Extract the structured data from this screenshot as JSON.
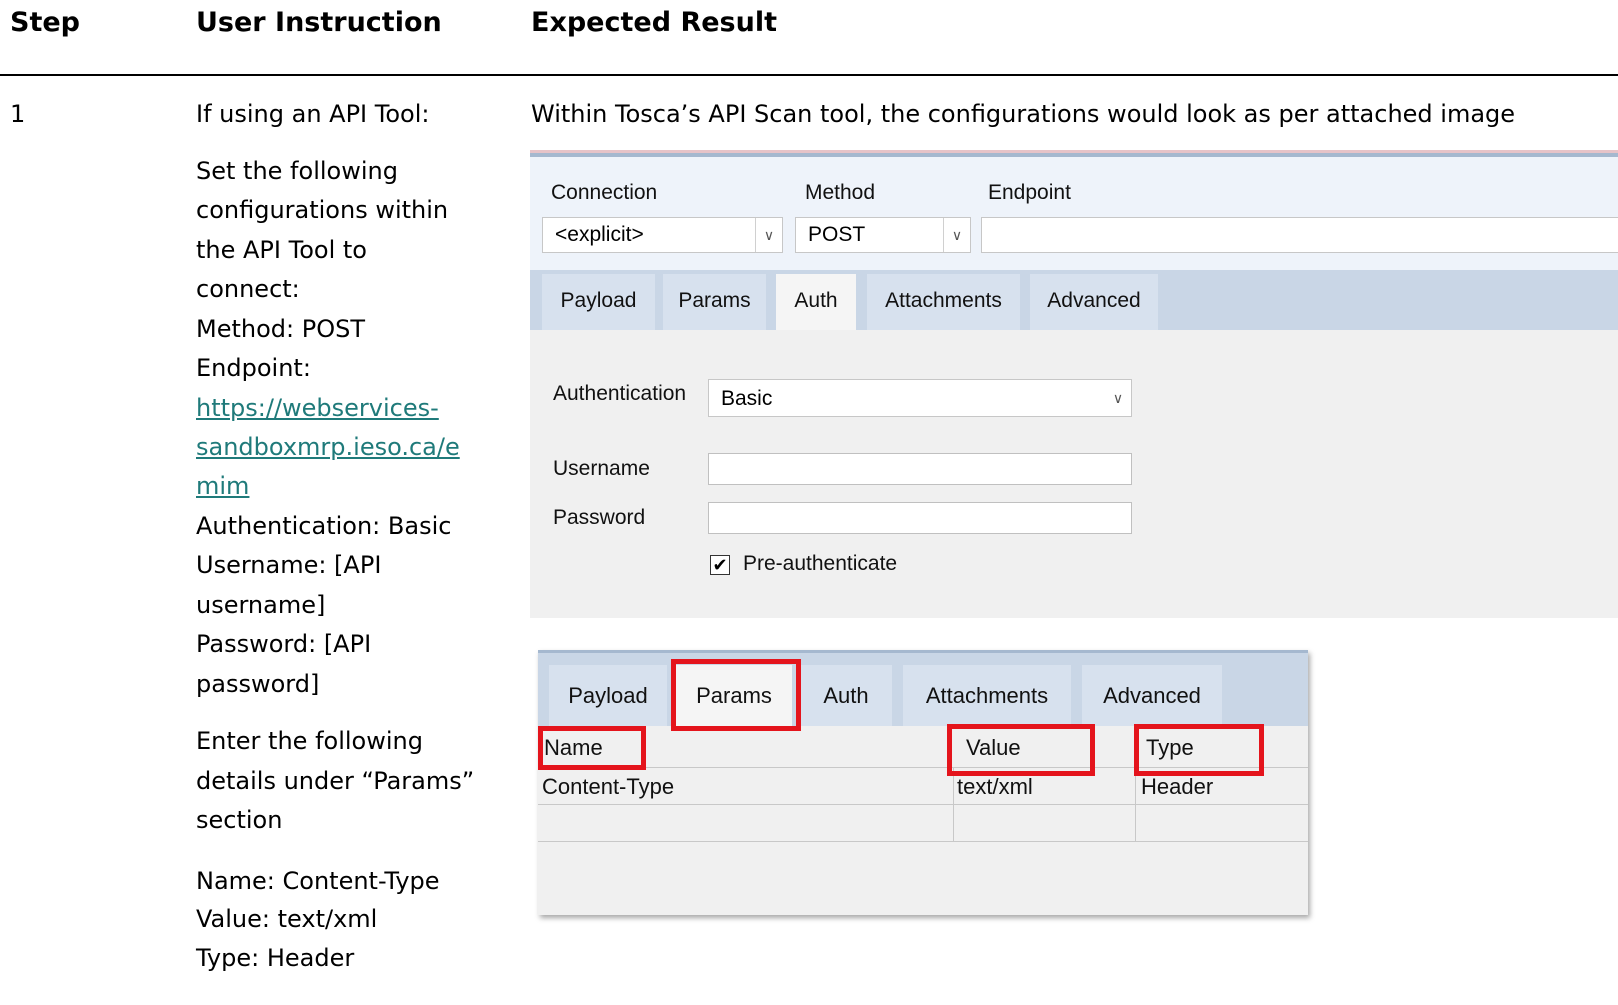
{
  "table": {
    "headers": {
      "step": "Step",
      "instruction": "User Instruction",
      "expected": "Expected Result"
    },
    "row": {
      "step": "1",
      "instruction": {
        "p1": "If using an API Tool:",
        "p2_lines": [
          "Set the following",
          "configurations within",
          "the API Tool to",
          "connect:",
          "Method: POST",
          "Endpoint:"
        ],
        "link_lines": [
          "https://webservices-",
          "sandboxmrp.ieso.ca/e",
          "mim"
        ],
        "p2_tail": [
          "Authentication: Basic",
          "Username: [API",
          "username]",
          "Password: [API",
          "password]"
        ],
        "p3_lines": [
          "Enter the following",
          "details under “Params”",
          "section"
        ],
        "p4_lines": [
          "Name: Content-Type",
          "Value: text/xml",
          "Type: Header"
        ]
      },
      "expected_text": "Within Tosca’s API Scan tool, the configurations would look as per attached image"
    }
  },
  "screenshot1": {
    "connection_label": "Connection",
    "method_label": "Method",
    "endpoint_label": "Endpoint",
    "connection_value": "<explicit>",
    "method_value": "POST",
    "tabs": [
      "Payload",
      "Params",
      "Auth",
      "Attachments",
      "Advanced"
    ],
    "active_tab": "Auth",
    "authentication_label": "Authentication",
    "authentication_value": "Basic",
    "username_label": "Username",
    "password_label": "Password",
    "preauth_label": "Pre-authenticate",
    "preauth_checked": true,
    "checkmark": "✔"
  },
  "screenshot2": {
    "tabs": [
      "Payload",
      "Params",
      "Auth",
      "Attachments",
      "Advanced"
    ],
    "active_tab": "Params",
    "columns": [
      "Name",
      "Value",
      "Type"
    ],
    "rows": [
      [
        "Content-Type",
        "text/xml",
        "Header"
      ]
    ],
    "highlight_color": "#e4141c"
  },
  "dropdown_icon": "∨"
}
